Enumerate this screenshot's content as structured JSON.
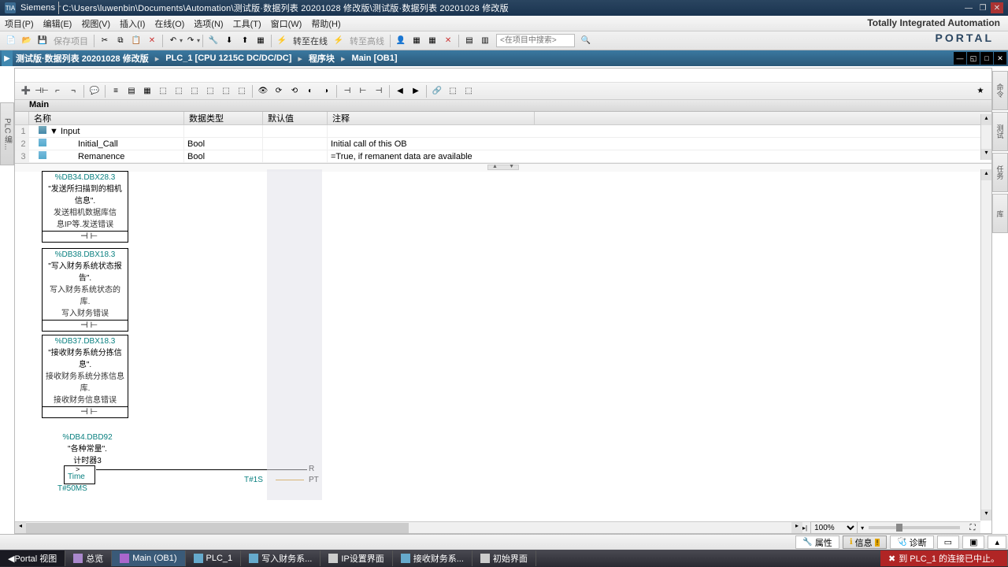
{
  "title": {
    "vendor": "Siemens",
    "path": "C:\\Users\\luwenbin\\Documents\\Automation\\测试版·数据列表 20201028 修改版\\测试版·数据列表 20201028 修改版"
  },
  "menu": {
    "items": [
      "项目(P)",
      "编辑(E)",
      "视图(V)",
      "插入(I)",
      "在线(O)",
      "选项(N)",
      "工具(T)",
      "窗口(W)",
      "帮助(H)"
    ]
  },
  "tia_label": "Totally Integrated Automation",
  "portal_label": "PORTAL",
  "toolbar": {
    "save": "保存项目",
    "go_online": "转至在线",
    "go_offline": "转至高线",
    "search_placeholder": "<在项目中搜索>"
  },
  "breadcrumb": {
    "items": [
      "测试版·数据列表 20201028 修改版",
      "PLC_1 [CPU 1215C DC/DC/DC]",
      "程序块",
      "Main [OB1]"
    ]
  },
  "block_name": "Main",
  "iface": {
    "cols": [
      "",
      "名称",
      "数据类型",
      "默认值",
      "注释"
    ],
    "rows": [
      {
        "n": "1",
        "icon": "struct",
        "expand": "▼",
        "name": "Input",
        "type": "",
        "def": "",
        "cmt": ""
      },
      {
        "n": "2",
        "icon": "in",
        "name": "Initial_Call",
        "type": "Bool",
        "def": "",
        "cmt": "Initial call of this OB"
      },
      {
        "n": "3",
        "icon": "in",
        "name": "Remanence",
        "type": "Bool",
        "def": "",
        "cmt": "=True, if remanent data are available"
      }
    ]
  },
  "ladder": {
    "blk1": {
      "addr": "%DB34.DBX28.3",
      "sym": "\"发送所扫描到的相机信息\".",
      "c1": "发送相机数据库信",
      "c2": "息IP等.发送错误"
    },
    "blk2": {
      "addr": "%DB38.DBX18.3",
      "sym": "\"写入财务系统状态报告\".",
      "c1": "写入财务系统状态的库.",
      "c2": "写入财务错误"
    },
    "blk3": {
      "addr": "%DB37.DBX18.3",
      "sym": "\"接收财务系统分拣信息\".",
      "c1": "接收财务系统分拣信息库.",
      "c2": "接收财务信息错误"
    },
    "blk4": {
      "addr": "%DB4.DBD92",
      "sym": "\"各种常量\".",
      "c1": "计时器3"
    },
    "timer": {
      "time_lbl": "Time",
      "pt_in": "T#1S",
      "pt_lbl": "PT",
      "r_lbl": "R",
      "iec": "T#50MS"
    }
  },
  "status": {
    "props": "属性",
    "info": "信息",
    "diag": "诊断",
    "zoom": "100%"
  },
  "tabs": {
    "portal": "Portal 视图",
    "items": [
      "总览",
      "Main (OB1)",
      "PLC_1",
      "写入财务系...",
      "IP设置界面",
      "接收财务系...",
      "初始界面"
    ],
    "error": "到 PLC_1 的连接已中止。"
  },
  "left_tab": "PLC 编...",
  "right_tabs": [
    "命令",
    "测试",
    "任务",
    "库"
  ]
}
